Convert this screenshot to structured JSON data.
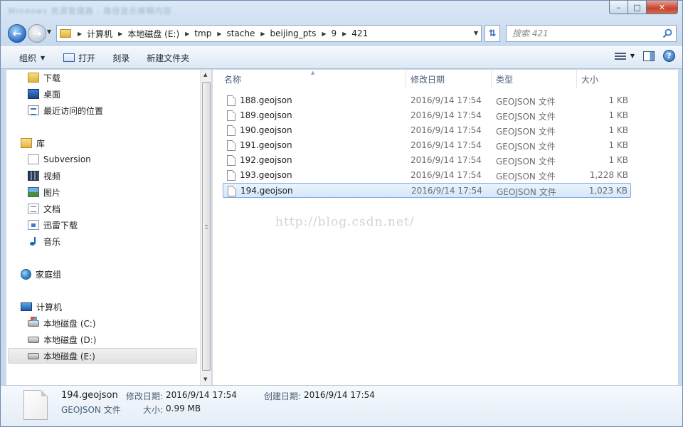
{
  "window": {
    "title": "Windows 资源管理器 - 路径显示模糊内容",
    "minimize": "–",
    "maximize": "□",
    "close": "✕"
  },
  "address": {
    "breadcrumbs": [
      "计算机",
      "本地磁盘 (E:)",
      "tmp",
      "stache",
      "beijing_pts",
      "9",
      "421"
    ]
  },
  "search": {
    "placeholder": "搜索 421"
  },
  "toolbar": {
    "organize": "组织",
    "open": "打开",
    "burn": "刻录",
    "new_folder": "新建文件夹",
    "help": "?"
  },
  "nav": {
    "items": [
      {
        "label": "下载",
        "icon": "downloads-folder-icon"
      },
      {
        "label": "桌面",
        "icon": "desktop-icon"
      },
      {
        "label": "最近访问的位置",
        "icon": "recent-places-icon"
      },
      {
        "label": "库",
        "icon": "libraries-icon"
      },
      {
        "label": "Subversion",
        "icon": "subversion-icon"
      },
      {
        "label": "视频",
        "icon": "videos-icon"
      },
      {
        "label": "图片",
        "icon": "pictures-icon"
      },
      {
        "label": "文档",
        "icon": "documents-icon"
      },
      {
        "label": "迅雷下载",
        "icon": "xunlei-downloads-icon"
      },
      {
        "label": "音乐",
        "icon": "music-icon"
      },
      {
        "label": "家庭组",
        "icon": "homegroup-icon"
      },
      {
        "label": "计算机",
        "icon": "computer-icon"
      },
      {
        "label": "本地磁盘 (C:)",
        "icon": "drive-c-icon"
      },
      {
        "label": "本地磁盘 (D:)",
        "icon": "drive-d-icon"
      },
      {
        "label": "本地磁盘 (E:)",
        "icon": "drive-e-icon"
      }
    ],
    "selected_index": 14
  },
  "columns": {
    "name": "名称",
    "date": "修改日期",
    "type": "类型",
    "size": "大小"
  },
  "files": [
    {
      "name": "188.geojson",
      "date": "2016/9/14 17:54",
      "type": "GEOJSON 文件",
      "size": "1 KB"
    },
    {
      "name": "189.geojson",
      "date": "2016/9/14 17:54",
      "type": "GEOJSON 文件",
      "size": "1 KB"
    },
    {
      "name": "190.geojson",
      "date": "2016/9/14 17:54",
      "type": "GEOJSON 文件",
      "size": "1 KB"
    },
    {
      "name": "191.geojson",
      "date": "2016/9/14 17:54",
      "type": "GEOJSON 文件",
      "size": "1 KB"
    },
    {
      "name": "192.geojson",
      "date": "2016/9/14 17:54",
      "type": "GEOJSON 文件",
      "size": "1 KB"
    },
    {
      "name": "193.geojson",
      "date": "2016/9/14 17:54",
      "type": "GEOJSON 文件",
      "size": "1,228 KB"
    },
    {
      "name": "194.geojson",
      "date": "2016/9/14 17:54",
      "type": "GEOJSON 文件",
      "size": "1,023 KB"
    }
  ],
  "selected_file_index": 6,
  "watermark": "http://blog.csdn.net/",
  "details": {
    "name": "194.geojson",
    "type": "GEOJSON 文件",
    "modified_label": "修改日期:",
    "modified_value": "2016/9/14 17:54",
    "created_label": "创建日期:",
    "created_value": "2016/9/14 17:54",
    "size_label": "大小:",
    "size_value": "0.99 MB"
  }
}
